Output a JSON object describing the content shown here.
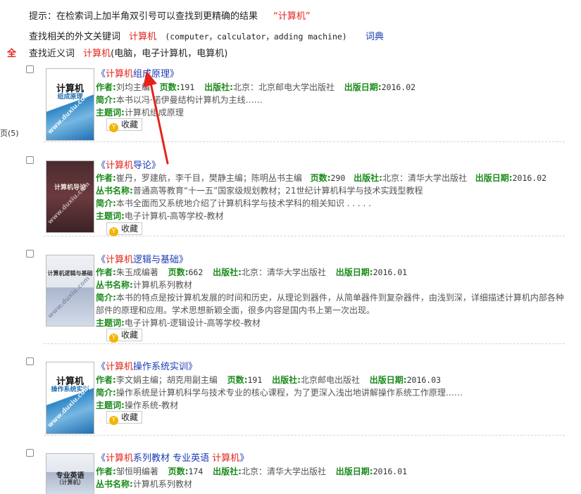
{
  "hints": {
    "tip_text": "提示：在检索词上加半角双引号可以查找到更精确的结果",
    "tip_example": "“计算机”",
    "foreign_label": "查找相关的外文关键词",
    "foreign_term": "计算机",
    "foreign_list": "(computer，calculator，adding machine)",
    "dict_link": "词典",
    "synonym_label": "查找近义词",
    "synonym_term": "计算机",
    "synonym_list": "(电脑，电子计算机，电算机)"
  },
  "sidebar": {
    "all_label": "全",
    "count_label": "页(5)"
  },
  "labels": {
    "author": "作者",
    "pages": "页数",
    "publisher": "出版社",
    "pub_date": "出版日期",
    "series": "丛书名称",
    "intro": "简介",
    "subject": "主题词",
    "favorite": "收藏"
  },
  "books": [
    {
      "cover_title": "计算机",
      "cover_subtitle": "组成原理",
      "title_open": "《",
      "title_hl": "计算机",
      "title_rest": "组成原理",
      "title_close": "》",
      "author": "刘均主编",
      "pages": "191",
      "publisher": "北京：北京邮电大学出版社",
      "pub_date": "2016.02",
      "intro": "本书以冯·诺伊曼结构计算机为主线……",
      "subject": "计算机组成原理"
    },
    {
      "cover_title": "计算机导论",
      "cover_subtitle": "",
      "title_open": "《",
      "title_hl": "计算机",
      "title_rest": "导论",
      "title_close": "》",
      "author": "崔丹，罗建航，李千目，樊静主编；陈明丛书主编",
      "pages": "290",
      "publisher": "北京：清华大学出版社",
      "pub_date": "2016.02",
      "series": "普通高等教育“十一五”国家级规划教材；21世纪计算机科学与技术实践型教程",
      "intro": "本书全面而又系统地介绍了计算机科学与技术学科的相关知识 . . . . .",
      "subject": "电子计算机-高等学校-教材"
    },
    {
      "cover_title": "计算机逻辑与基础",
      "cover_subtitle": "",
      "title_open": "《",
      "title_hl": "计算机",
      "title_rest": "逻辑与基础",
      "title_close": "》",
      "author": "朱玉成编著",
      "pages": "662",
      "publisher": "北京：清华大学出版社",
      "pub_date": "2016.01",
      "series": "计算机系列教材",
      "intro_line1": "本书的特点是按计算机发展的时间和历史，从理论到器件，从简单器件到复杂器件，由浅到深，详细描述计算机内部各种",
      "intro_line2": "部件的原理和应用。学术思想新颖全面，很多内容是国内书上第一次出现。",
      "subject": "电子计算机-逻辑设计-高等学校-教材"
    },
    {
      "cover_title": "计算机",
      "cover_subtitle": "操作系统实训",
      "title_open": "《",
      "title_hl": "计算机",
      "title_rest": "操作系统实训",
      "title_close": "》",
      "author": "李文娟主编；胡克用副主编",
      "pages": "191",
      "publisher": "北京邮电出版社",
      "pub_date": "2016.03",
      "intro": "操作系统是计算机科学与技术专业的核心课程，为了更深入浅出地讲解操作系统工作原理……",
      "subject": "操作系统-教材"
    },
    {
      "cover_title": "专业英语",
      "cover_subtitle": "（计算机）",
      "title_open": "《",
      "title_hl": "计算机",
      "title_rest": "系列教材 专业英语 ",
      "title_hl2": "计算机",
      "title_close": "》",
      "author": "邹恒明编著",
      "pages": "174",
      "publisher": "北京：清华大学出版社",
      "pub_date": "2016.01",
      "series": "计算机系列教材"
    }
  ],
  "cover_watermark": "www.duxiu.com"
}
